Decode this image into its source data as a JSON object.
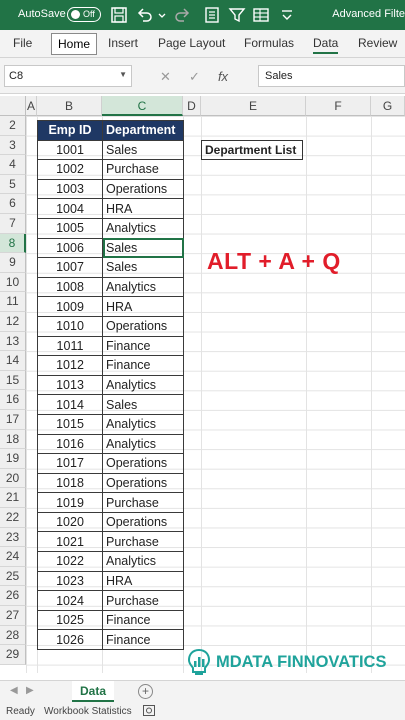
{
  "titlebar": {
    "autosave_label": "AutoSave",
    "autosave_state": "Off",
    "document_title": "Advanced Filte"
  },
  "ribbon": {
    "tabs": [
      "File",
      "Home",
      "Insert",
      "Page Layout",
      "Formulas",
      "Data",
      "Review"
    ],
    "active_tab": "Home"
  },
  "formula_bar": {
    "name_box": "C8",
    "formula": "Sales"
  },
  "columns": [
    "A",
    "B",
    "C",
    "D",
    "E",
    "F",
    "G"
  ],
  "rows": [
    "2",
    "3",
    "4",
    "5",
    "6",
    "7",
    "8",
    "9",
    "10",
    "11",
    "12",
    "13",
    "14",
    "15",
    "16",
    "17",
    "18",
    "19",
    "20",
    "21",
    "22",
    "23",
    "24",
    "25",
    "26",
    "27",
    "28",
    "29"
  ],
  "table": {
    "headers": {
      "emp_id": "Emp ID",
      "department": "Department"
    },
    "rows": [
      {
        "id": "1001",
        "dept": "Sales"
      },
      {
        "id": "1002",
        "dept": "Purchase"
      },
      {
        "id": "1003",
        "dept": "Operations"
      },
      {
        "id": "1004",
        "dept": "HRA"
      },
      {
        "id": "1005",
        "dept": "Analytics"
      },
      {
        "id": "1006",
        "dept": "Sales"
      },
      {
        "id": "1007",
        "dept": "Sales"
      },
      {
        "id": "1008",
        "dept": "Analytics"
      },
      {
        "id": "1009",
        "dept": "HRA"
      },
      {
        "id": "1010",
        "dept": "Operations"
      },
      {
        "id": "1011",
        "dept": "Finance"
      },
      {
        "id": "1012",
        "dept": "Finance"
      },
      {
        "id": "1013",
        "dept": "Analytics"
      },
      {
        "id": "1014",
        "dept": "Sales"
      },
      {
        "id": "1015",
        "dept": "Analytics"
      },
      {
        "id": "1016",
        "dept": "Analytics"
      },
      {
        "id": "1017",
        "dept": "Operations"
      },
      {
        "id": "1018",
        "dept": "Operations"
      },
      {
        "id": "1019",
        "dept": "Purchase"
      },
      {
        "id": "1020",
        "dept": "Operations"
      },
      {
        "id": "1021",
        "dept": "Purchase"
      },
      {
        "id": "1022",
        "dept": "Analytics"
      },
      {
        "id": "1023",
        "dept": "HRA"
      },
      {
        "id": "1024",
        "dept": "Purchase"
      },
      {
        "id": "1025",
        "dept": "Finance"
      },
      {
        "id": "1026",
        "dept": "Finance"
      }
    ]
  },
  "department_list_label": "Department List",
  "hotkey_text": "ALT + A + Q",
  "brand_name": "MDATA FINNOVATICS",
  "sheet_tab": "Data",
  "status": {
    "ready": "Ready",
    "workbook_statistics": "Workbook Statistics"
  },
  "colors": {
    "excel_green": "#217346",
    "header_navy": "#1f3864",
    "hotkey_red": "#e11d2a",
    "brand_teal": "#1fa39b"
  }
}
